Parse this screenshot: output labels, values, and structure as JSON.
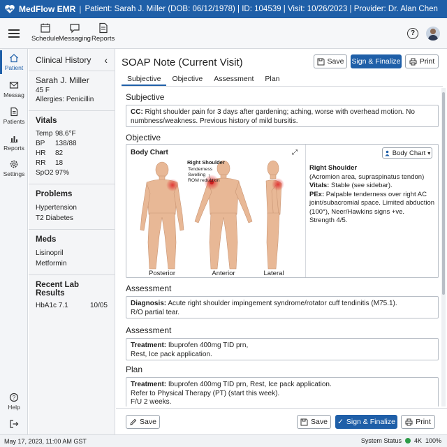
{
  "app": {
    "name": "MedFlow EMR",
    "context": "Patient: Sarah J. Miller (DOB: 06/12/1978) | ID: 104539 | Visit: 10/26/2023 | Provider: Dr. Alan Chen"
  },
  "toolbar": {
    "schedule": "Schedule",
    "messaging": "Messaging",
    "reports": "Reports",
    "help": "?"
  },
  "nav": {
    "patient": "Patient",
    "messages": "Messag",
    "patients": "Patients",
    "reports": "Reports",
    "settings": "Settings",
    "help": "Help"
  },
  "history": {
    "title": "Clinical History",
    "collapse": "‹",
    "patient_name": "Sarah J. Miller",
    "age_sex": "45 F",
    "allergies": "Allergies: Penicillin",
    "vitals_title": "Vitals",
    "vitals": [
      {
        "k": "Temp",
        "v": "98.6°F"
      },
      {
        "k": "BP",
        "v": "138/88"
      },
      {
        "k": "HR",
        "v": "82"
      },
      {
        "k": "RR",
        "v": "18"
      },
      {
        "k": "SpO2",
        "v": "97%"
      }
    ],
    "problems_title": "Problems",
    "problems": [
      "Hypertension",
      "T2 Diabetes"
    ],
    "meds_title": "Meds",
    "meds": [
      "Lisinopril",
      "Metformin"
    ],
    "labs_title": "Recent Lab Results",
    "lab": {
      "name": "HbA1c 7.1",
      "date": "10/05"
    }
  },
  "main": {
    "title": "SOAP Note (Current Visit)",
    "save": "Save",
    "sign": "Sign & Finalize",
    "print": "Print",
    "tabs": [
      "Subjective",
      "Objective",
      "Assessment",
      "Plan"
    ],
    "subjective_title": "Subjective",
    "cc_label": "CC:",
    "cc_text": " Right shoulder pain for 3 days after gardening; aching, worse with overhead motion. No numbness/weakness. Previous history of mild bursitis.",
    "objective_title": "Objective",
    "body_chart": {
      "title": "Body Chart",
      "expand": "⤢",
      "dropdown": "Body Chart",
      "annot_title": "Right Shoulder",
      "annot_lines": [
        "Tenderness",
        "Swelling",
        "ROM reduction"
      ],
      "views": [
        "Posterior",
        "Anterior",
        "Lateral"
      ],
      "desc_title": "Right Shoulder",
      "desc_sub": "(Acromion area, supraspinatus tendon)",
      "vitals_label": "Vitals:",
      "vitals_text": " Stable (see sidebar).",
      "pex_label": "PEx:",
      "pex_text": " Palpable tenderness over right AC joint/subacromial space. Limited abduction (100°), Neer/Hawkins signs +ve.",
      "strength": "Strength 4/5."
    },
    "assessment_title": "Assessment",
    "dx_label": "Diagnosis:",
    "dx_text": " Acute right shoulder impingement syndrome/rotator cuff tendinitis (M75.1).",
    "dx_line2": "R/O partial tear.",
    "assessment2_title": "Assessment",
    "tx_label": "Treatment:",
    "tx_text": " Ibuprofen 400mg TID prn,",
    "tx_line2": "Rest, Ice pack application.",
    "plan_title": "Plan",
    "plan_label": "Treatment:",
    "plan_text": " Ibuprofen 400mg TID prn, Rest, Ice pack application.",
    "plan_line2": "Refer to Physical Therapy (PT) (start this week).",
    "plan_line3": "F/U 2 weeks."
  },
  "footer": {
    "save_left": "Save",
    "save": "Save",
    "sign": "Sign & Finalize",
    "print": "Print"
  },
  "status": {
    "datetime": "May 17, 2023, 11:00 AM  GST",
    "label": "System Status",
    "resolution": "4K",
    "zoom": "100%",
    "status_color": "#2e9b48"
  },
  "colors": {
    "accent": "#1f5fa8",
    "highlight": "#e03030"
  }
}
